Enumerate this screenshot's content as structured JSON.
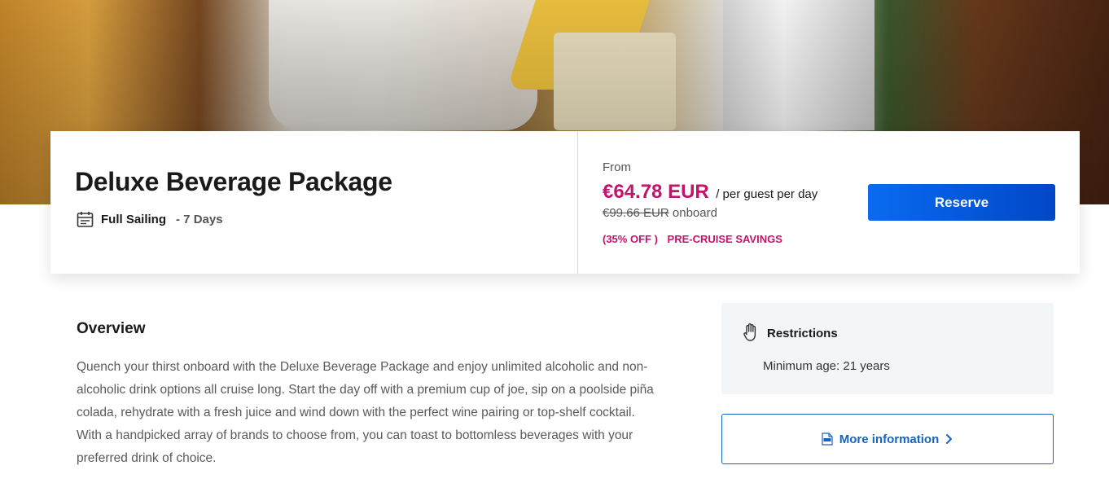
{
  "product": {
    "title": "Deluxe Beverage Package",
    "sailing_label": "Full Sailing",
    "days_label": "- 7 Days"
  },
  "pricing": {
    "from_label": "From",
    "price": "€64.78 EUR",
    "per_label": "/ per guest per day",
    "original_price": "€99.66 EUR",
    "onboard_label": "onboard",
    "discount_label": "(35% OFF )",
    "savings_label": "PRE-CRUISE SAVINGS"
  },
  "actions": {
    "reserve_label": "Reserve",
    "more_info_label": "More information"
  },
  "overview": {
    "heading": "Overview",
    "body": "Quench your thirst onboard with the Deluxe Beverage Package and enjoy unlimited alcoholic and non-alcoholic drink options all cruise long. Start the day off with a premium cup of joe, sip on a poolside piña colada, rehydrate with a fresh juice and wind down with the perfect wine pairing or top-shelf cocktail. With a handpicked array of brands to choose from, you can toast to bottomless beverages with your preferred drink of choice."
  },
  "restrictions": {
    "heading": "Restrictions",
    "text": "Minimum age: 21 years"
  },
  "icons": {
    "calendar": "calendar-icon",
    "hand": "hand-icon",
    "pdf": "pdf-icon",
    "chevron": "chevron-right-icon"
  },
  "colors": {
    "price_accent": "#c4136c",
    "button": "#0a6bf0",
    "link": "#1565c0",
    "restrictions_bg": "#f3f6f8"
  }
}
